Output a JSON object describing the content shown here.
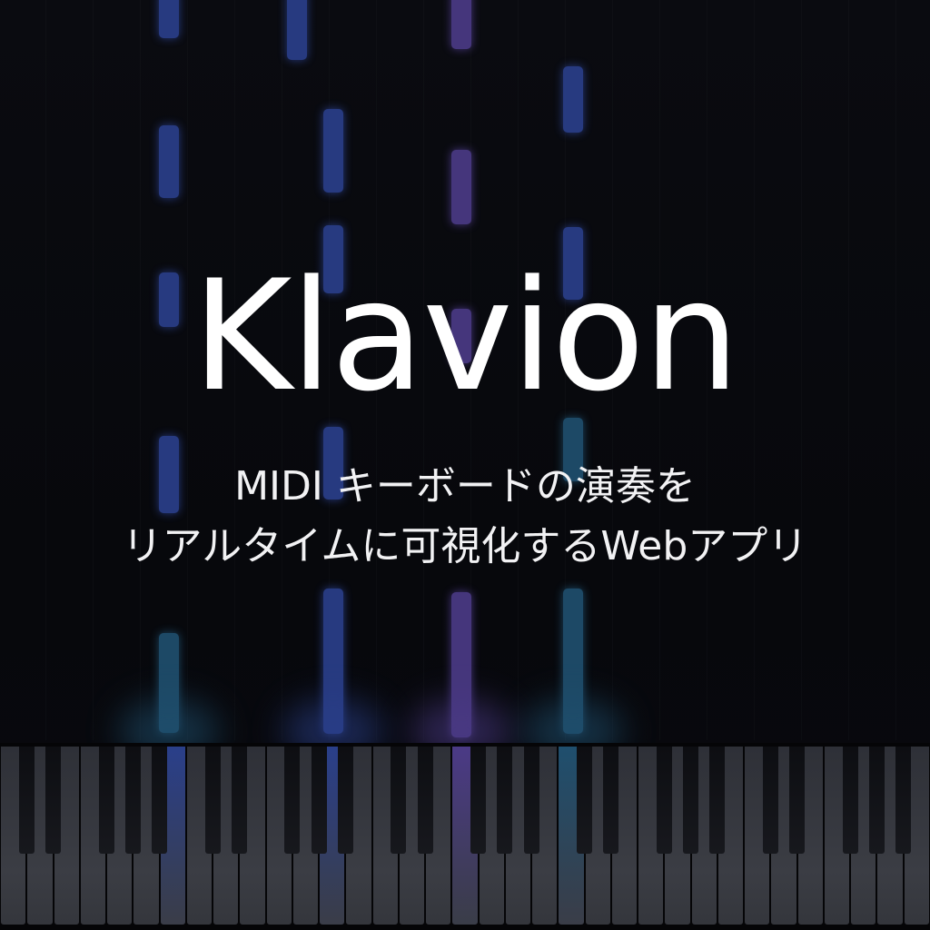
{
  "app": {
    "title": "Klavion",
    "subtitle_line1": "MIDI キーボードの演奏を",
    "subtitle_line2": "リアルタイムに可視化するWebアプリ"
  },
  "colors": {
    "background": "#08090d",
    "blue_note": "#2a3f8a",
    "purple_note": "#4b3a86",
    "teal_note": "#1f4f6e",
    "text": "#ffffff"
  }
}
